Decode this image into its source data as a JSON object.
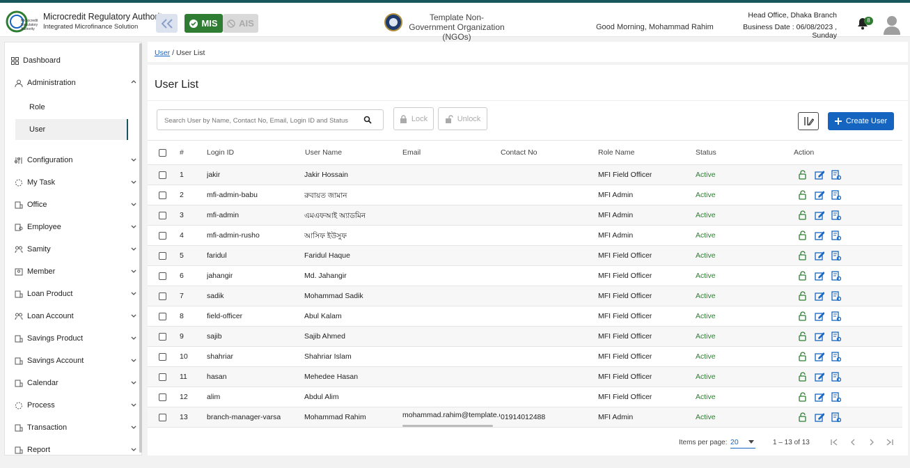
{
  "header": {
    "brand_title": "Microcredit Regulatory Authority",
    "brand_sub": "Integrated Microfinance Solution",
    "mis_label": "MIS",
    "ais_label": "AIS",
    "org_name": "Template Non-Government Organization (NGOs)",
    "greeting": "Good Morning, Mohammad Rahim",
    "branch": "Head Office, Dhaka Branch",
    "business_date": "Business Date : 06/08/2023 , Sunday",
    "notification_count": "8"
  },
  "sidebar": {
    "dashboard": "Dashboard",
    "items": [
      {
        "label": "Administration",
        "icon": "admin-icon"
      },
      {
        "label": "Role"
      },
      {
        "label": "User"
      },
      {
        "label": "Configuration",
        "icon": "config-icon"
      },
      {
        "label": "My Task",
        "icon": "task-icon"
      },
      {
        "label": "Office",
        "icon": "office-icon"
      },
      {
        "label": "Employee",
        "icon": "employee-icon"
      },
      {
        "label": "Samity",
        "icon": "samity-icon"
      },
      {
        "label": "Member",
        "icon": "member-icon"
      },
      {
        "label": "Loan Product",
        "icon": "loan-product-icon"
      },
      {
        "label": "Loan Account",
        "icon": "loan-account-icon"
      },
      {
        "label": "Savings Product",
        "icon": "savings-product-icon"
      },
      {
        "label": "Savings Account",
        "icon": "savings-account-icon"
      },
      {
        "label": "Calendar",
        "icon": "calendar-icon"
      },
      {
        "label": "Process",
        "icon": "process-icon"
      },
      {
        "label": "Transaction",
        "icon": "transaction-icon"
      },
      {
        "label": "Report",
        "icon": "report-icon"
      }
    ]
  },
  "breadcrumb": {
    "parent": "User",
    "sep": "/",
    "current": "User List"
  },
  "page_title": "User List",
  "toolbar": {
    "search_placeholder": "Search User by Name, Contact No, Email, Login ID and Status",
    "lock_label": "Lock",
    "unlock_label": "Unlock",
    "create_label": "Create User"
  },
  "table": {
    "headers": [
      "#",
      "Login ID",
      "User Name",
      "Email",
      "Contact No",
      "Role Name",
      "Status",
      "Action"
    ],
    "rows": [
      [
        "1",
        "jakir",
        "Jakir Hossain",
        "",
        "",
        "MFI Field Officer",
        "Active"
      ],
      [
        "2",
        "mfi-admin-babu",
        "রুবায়ত জামান",
        "",
        "",
        "MFI Admin",
        "Active"
      ],
      [
        "3",
        "mfi-admin",
        "এমএফআই অ্যাডমিন",
        "",
        "",
        "MFI Admin",
        "Active"
      ],
      [
        "4",
        "mfi-admin-rusho",
        "আসিফ ইউসুফ",
        "",
        "",
        "MFI Admin",
        "Active"
      ],
      [
        "5",
        "faridul",
        "Faridul Haque",
        "",
        "",
        "MFI Field Officer",
        "Active"
      ],
      [
        "6",
        "jahangir",
        "Md. Jahangir",
        "",
        "",
        "MFI Field Officer",
        "Active"
      ],
      [
        "7",
        "sadik",
        "Mohammad Sadik",
        "",
        "",
        "MFI Field Officer",
        "Active"
      ],
      [
        "8",
        "field-officer",
        "Abul Kalam",
        "",
        "",
        "MFI Field Officer",
        "Active"
      ],
      [
        "9",
        "sajib",
        "Sajib Ahmed",
        "",
        "",
        "MFI Field Officer",
        "Active"
      ],
      [
        "10",
        "shahriar",
        "Shahriar Islam",
        "",
        "",
        "MFI Field Officer",
        "Active"
      ],
      [
        "11",
        "hasan",
        "Mehedee Hasan",
        "",
        "",
        "MFI Field Officer",
        "Active"
      ],
      [
        "12",
        "alim",
        "Abdul Alim",
        "",
        "",
        "MFI Field Officer",
        "Active"
      ],
      [
        "13",
        "branch-manager-varsa",
        "Mohammad Rahim",
        "mohammad.rahim@template.c",
        "01914012488",
        "MFI Admin",
        "Active"
      ]
    ]
  },
  "paginator": {
    "items_per_page_label": "Items per page:",
    "items_per_page": "20",
    "range": "1 – 13 of 13"
  },
  "colors": {
    "primary": "#1565c0",
    "success": "#2e7d32",
    "accent": "#17565c"
  }
}
